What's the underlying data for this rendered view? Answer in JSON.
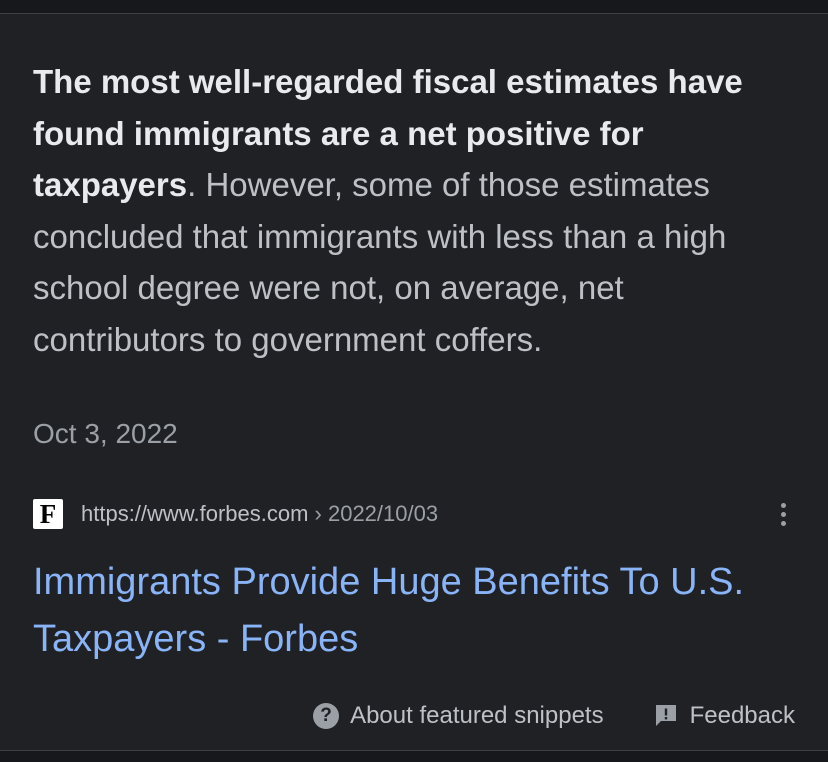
{
  "snippet": {
    "bold_text": "The most well-regarded fiscal estimates have found immigrants are a net positive for taxpayers",
    "rest_text": ". However, some of those estimates concluded that immigrants with less than a high school degree were not, on average, net contributors to government coffers.",
    "date": "Oct 3, 2022"
  },
  "source": {
    "favicon_letter": "F",
    "site_url": "https://www.forbes.com",
    "path": " › 2022/10/03",
    "more_icon": "more-vert-icon"
  },
  "result": {
    "title": "Immigrants Provide Huge Benefits To U.S. Taxpayers - Forbes"
  },
  "footer": {
    "about_label": "About featured snippets",
    "about_icon": "help-circle-icon",
    "feedback_label": "Feedback",
    "feedback_icon": "feedback-icon"
  },
  "colors": {
    "background": "#202124",
    "text": "#bdc1c6",
    "bold_text": "#e8eaed",
    "muted": "#9aa0a6",
    "link": "#8ab4f8"
  }
}
